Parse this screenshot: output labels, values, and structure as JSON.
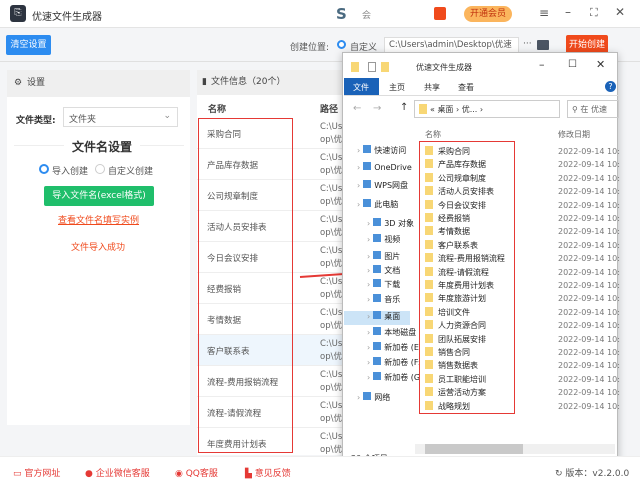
{
  "app": {
    "title": "优速文件生成器",
    "logo_text": "S",
    "member_label": "会",
    "vip_label": "开通会员",
    "accent": "#2d8cf0",
    "start_color": "#f04a1c"
  },
  "toolbar": {
    "clear_label": "清空设置",
    "location_label": "创建位置:",
    "custom_label": "自定义",
    "path_value": "C:\\Users\\admin\\Desktop\\优速",
    "more_label": "···",
    "start_label": "开始创建"
  },
  "settings": {
    "header": "设置",
    "file_type_label": "文件类型:",
    "file_type_value": "文件夹",
    "name_section": "文件名设置",
    "radio_import": "导入创建",
    "radio_custom": "自定义创建",
    "import_button": "导入文件名(excel格式)",
    "example_link": "查看文件名填写实例",
    "status": "文件导入成功"
  },
  "fileinfo": {
    "header": "文件信息（20个）",
    "col_name": "名称",
    "col_path": "路径",
    "rows": [
      {
        "name": "采购合同",
        "path1": "C:\\Us",
        "path2": "op\\优"
      },
      {
        "name": "产品库存数据",
        "path1": "C:\\Us",
        "path2": "op\\优"
      },
      {
        "name": "公司规章制度",
        "path1": "C:\\Us",
        "path2": "op\\优"
      },
      {
        "name": "活动人员安排表",
        "path1": "C:\\Us",
        "path2": "op\\优"
      },
      {
        "name": "今日会议安排",
        "path1": "C:\\Us",
        "path2": "op\\优"
      },
      {
        "name": "经费报销",
        "path1": "C:\\Us",
        "path2": "op\\优"
      },
      {
        "name": "考情数据",
        "path1": "C:\\Us",
        "path2": "op\\优"
      },
      {
        "name": "客户联系表",
        "path1": "C:\\Us",
        "path2": "op\\优"
      },
      {
        "name": "流程-费用报销流程",
        "path1": "C:\\Us",
        "path2": "op\\优"
      },
      {
        "name": "流程-请假流程",
        "path1": "C:\\Us",
        "path2": "op\\优"
      },
      {
        "name": "年度费用计划表",
        "path1": "C:\\Us",
        "path2": "op\\优"
      }
    ]
  },
  "explorer": {
    "title": "优速文件生成器",
    "tabs": [
      "文件",
      "主页",
      "共享",
      "查看"
    ],
    "address": "« 桌面 › 优... ›",
    "search_placeholder": "在 优速",
    "col_name": "名称",
    "col_date": "修改日期",
    "nav": [
      "快速访问",
      "OneDrive",
      "WPS网盘",
      "此电脑",
      "3D 对象",
      "视频",
      "图片",
      "文档",
      "下载",
      "音乐",
      "桌面",
      "本地磁盘",
      "新加卷 (E",
      "新加卷 (F:",
      "新加卷 (G",
      "网络"
    ],
    "files": [
      "采购合同",
      "产品库存数据",
      "公司规章制度",
      "活动人员安排表",
      "今日会议安排",
      "经费报销",
      "考情数据",
      "客户联系表",
      "流程-费用报销流程",
      "流程-请假流程",
      "年度费用计划表",
      "年度旅游计划",
      "培训文件",
      "人力资源合同",
      "团队拓展安排",
      "销售合同",
      "销售数据表",
      "员工职能培训",
      "运营活动方案",
      "战略规划"
    ],
    "date": "2022-09-14 10:",
    "status": "20 个项目"
  },
  "footer": {
    "links": [
      "官方网址",
      "企业微信客服",
      "QQ客服",
      "意见反馈"
    ],
    "version": "版本：v2.2.0.0"
  }
}
